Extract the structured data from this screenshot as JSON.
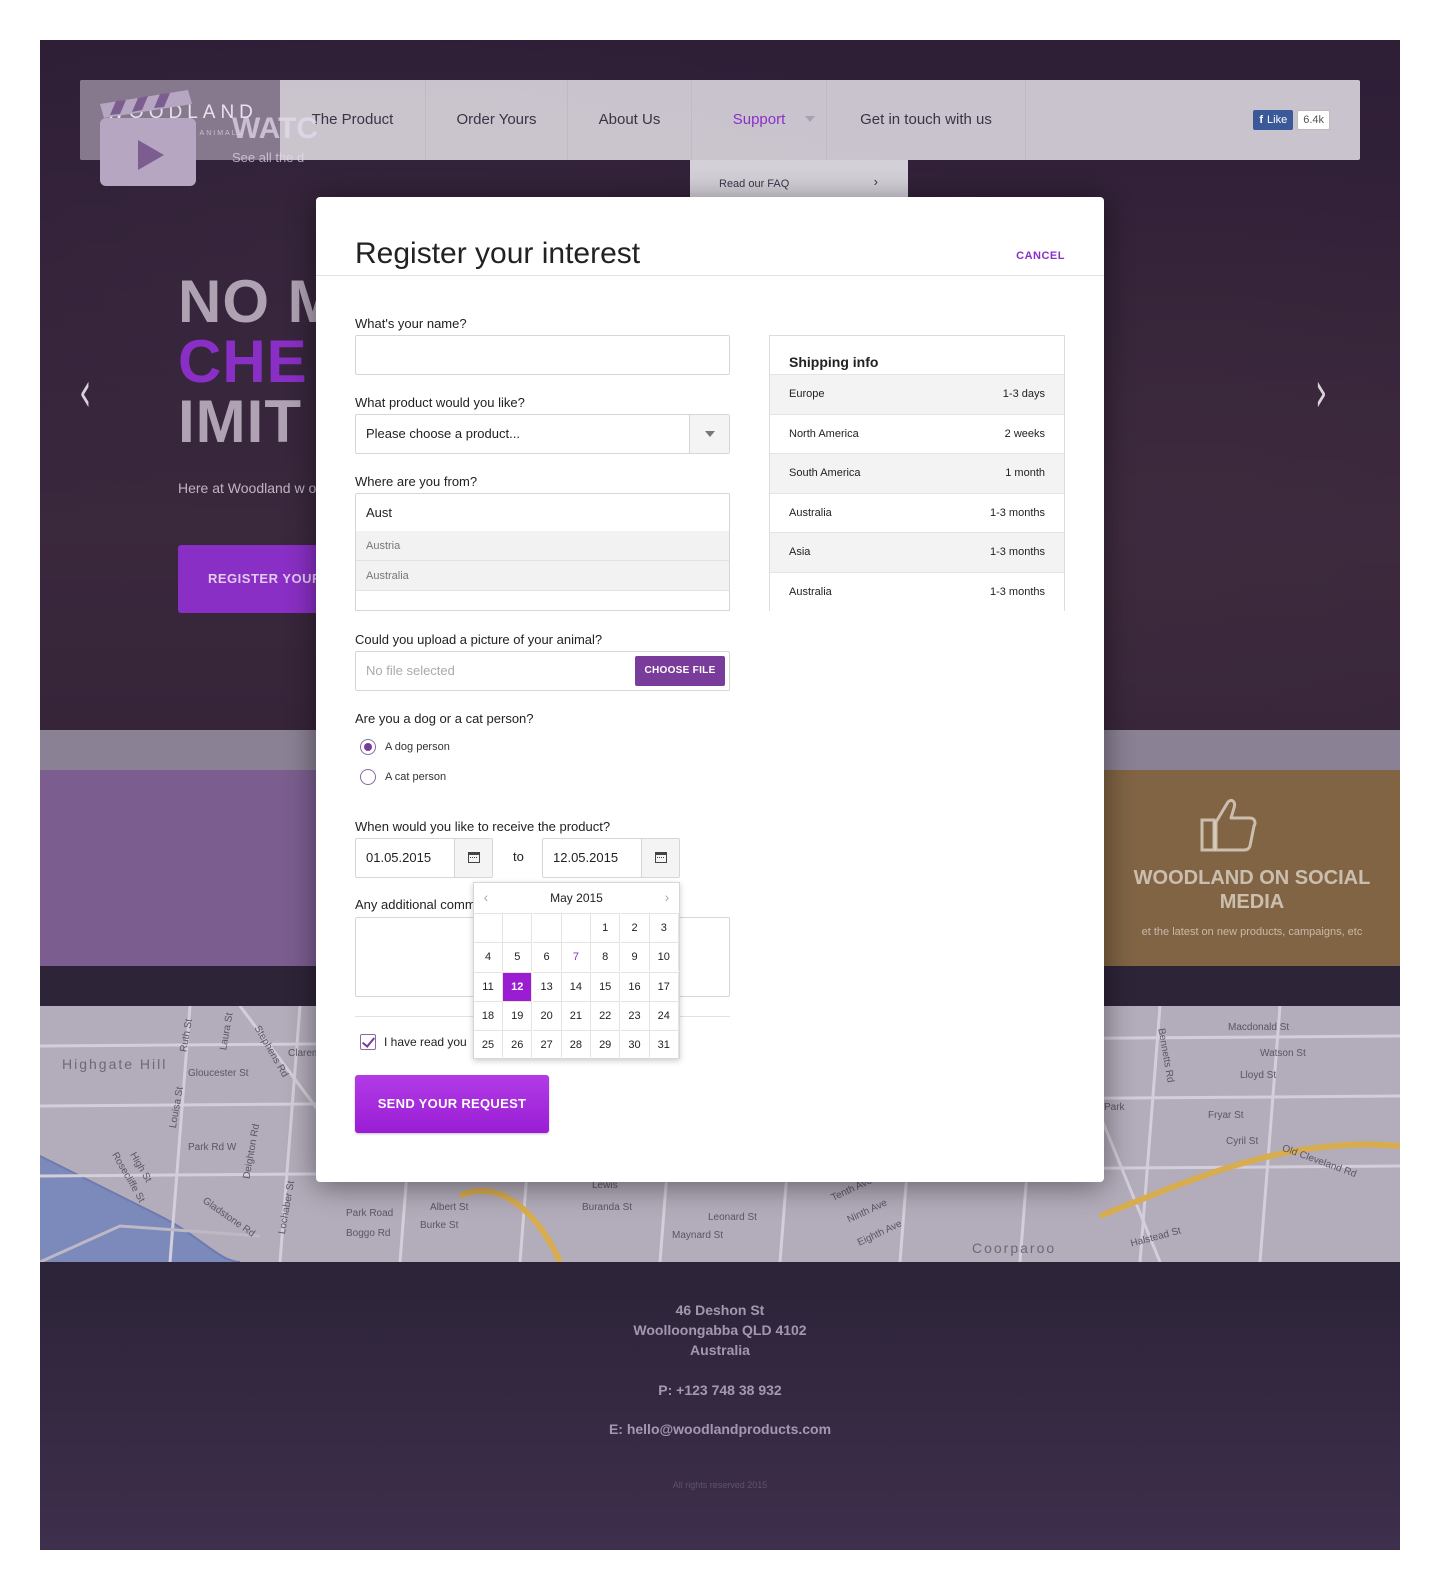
{
  "nav": {
    "logo": "WOODLAND",
    "logo_sub": "PRODUCTS FOR ANIMALS",
    "items": [
      {
        "label": "The Product"
      },
      {
        "label": "Order Yours"
      },
      {
        "label": "About Us"
      },
      {
        "label": "Support"
      },
      {
        "label": "Get in touch with us"
      }
    ],
    "fb_like": "Like",
    "fb_count": "6.4k",
    "support_dropdown": {
      "faq": "Read our FAQ"
    }
  },
  "hero": {
    "line1": "NO M",
    "line2": "CHE",
    "line3": "IMIT",
    "text": "Here at Woodland w obsessed over in ou",
    "cta": "REGISTER YOUR"
  },
  "features": {
    "watch_title": "WATC",
    "watch_sub": "See all the d",
    "social_title": "WOODLAND ON SOCIAL MEDIA",
    "social_sub": "et the latest on new products, campaigns, etc"
  },
  "map": {
    "labels": [
      "Highgate Hill",
      "Gloucester St",
      "Park Rd W",
      "Park Road",
      "Boggo Rd",
      "Gladstone Rd",
      "Albert St",
      "Burke St",
      "Lewis",
      "Buranda St",
      "Maynard St",
      "Leonard St",
      "Tenth Ave",
      "Ninth Ave",
      "Eighth Ave",
      "Coorparoo",
      "Park",
      "Macdonald St",
      "Watson St",
      "Lloyd St",
      "Fryar St",
      "Cyril St",
      "Old Cleveland Rd",
      "Halstead St",
      "Bennetts Rd",
      "Stephens Rd",
      "Ruth St",
      "Laura St",
      "Louisa St",
      "Deighton Rd",
      "Lochaber St",
      "High St",
      "Rosecliffe St",
      "Clarem"
    ]
  },
  "footer": {
    "address1": "46 Deshon St",
    "address2": "Woolloongabba QLD 4102",
    "address3": "Australia",
    "phone": "P: +123 748 38 932",
    "email": "E: hello@woodlandproducts.com",
    "rights": "All rights reserved 2015"
  },
  "modal": {
    "title": "Register your interest",
    "cancel": "CANCEL",
    "name_label": "What's your name?",
    "name_value": "",
    "product_label": "What product would you like?",
    "product_value": "Please choose a product...",
    "country_label": "Where are you from?",
    "country_value": "Aust",
    "country_options": [
      "Austria",
      "Australia"
    ],
    "upload_label": "Could you upload a picture of your animal?",
    "upload_placeholder": "No file selected",
    "upload_button": "CHOOSE FILE",
    "person_label": "Are you a dog or a cat person?",
    "person_options": [
      {
        "label": "A dog person",
        "checked": true
      },
      {
        "label": "A cat person",
        "checked": false
      }
    ],
    "date_label": "When would you like to receive the product?",
    "date_from": "01.05.2015",
    "date_to_word": "to",
    "date_to": "12.05.2015",
    "comments_label": "Any additional comm",
    "terms_label": "I have read you",
    "terms_checked": true,
    "submit": "SEND YOUR REQUEST"
  },
  "shipping": {
    "title": "Shipping info",
    "rows": [
      {
        "region": "Europe",
        "time": "1-3 days"
      },
      {
        "region": "North America",
        "time": "2 weeks"
      },
      {
        "region": "South America",
        "time": "1 month"
      },
      {
        "region": "Australia",
        "time": "1-3 months"
      },
      {
        "region": "Asia",
        "time": "1-3 months"
      },
      {
        "region": "Australia",
        "time": "1-3 months"
      }
    ]
  },
  "calendar": {
    "month": "May 2015",
    "weeks": [
      [
        "",
        "",
        "",
        "",
        "1",
        "2",
        "3"
      ],
      [
        "4",
        "5",
        "6",
        "7",
        "8",
        "9",
        "10"
      ],
      [
        "11",
        "12",
        "13",
        "14",
        "15",
        "16",
        "17"
      ],
      [
        "18",
        "19",
        "20",
        "21",
        "22",
        "23",
        "24"
      ],
      [
        "25",
        "26",
        "27",
        "28",
        "29",
        "30",
        "31"
      ]
    ],
    "today": "7",
    "selected": "12"
  },
  "colors": {
    "accent": "#9a1dd4",
    "accent_dark": "#7a3c9a",
    "hero_overlay": "#26123a",
    "social_panel": "#806444",
    "watch_panel": "#7b5e8f"
  }
}
